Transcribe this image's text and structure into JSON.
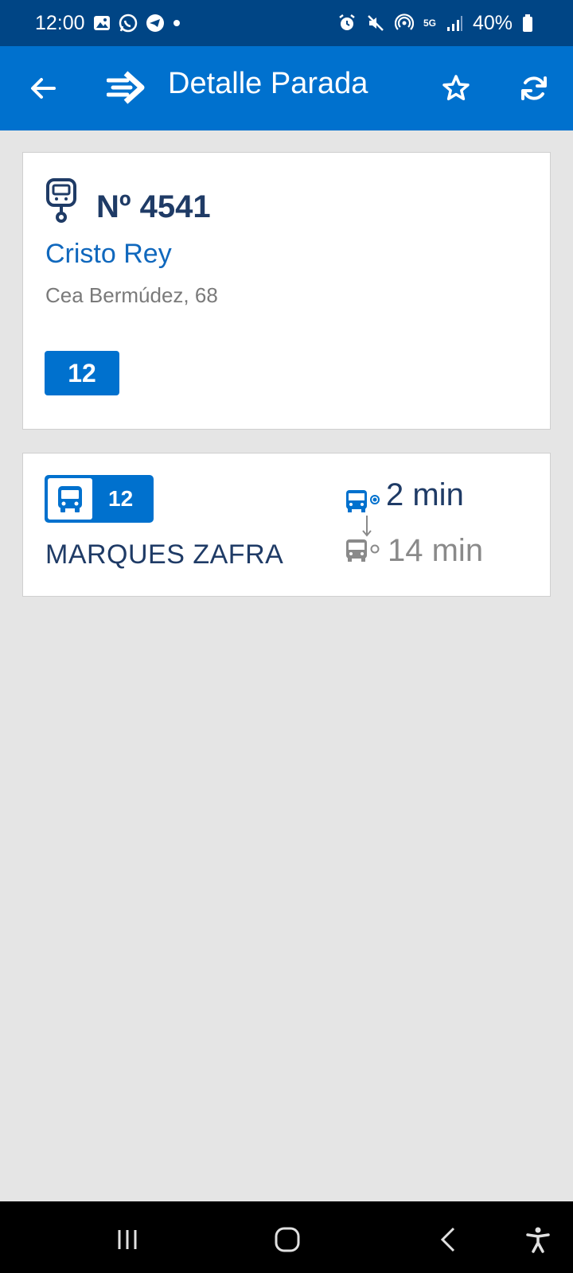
{
  "status_bar": {
    "time": "12:00",
    "battery": "40%",
    "network": "5G",
    "icons": [
      "gallery-icon",
      "whatsapp-icon",
      "telegram-icon",
      "dot-icon",
      "alarm-icon",
      "mute-icon",
      "hotspot-icon",
      "signal-icon",
      "battery-icon"
    ]
  },
  "app_bar": {
    "title": "Detalle Parada",
    "icons": [
      "back-arrow-icon",
      "app-logo-icon",
      "star-icon",
      "refresh-icon"
    ]
  },
  "stop": {
    "number": "Nº 4541",
    "name": "Cristo Rey",
    "address": "Cea Bermúdez, 68",
    "lines": [
      "12"
    ]
  },
  "arrivals": [
    {
      "line": "12",
      "destination": "MARQUES ZAFRA",
      "next": "2 min",
      "following": "14 min"
    }
  ],
  "colors": {
    "status_bar": "#004585",
    "primary": "#0071ce",
    "dark_text": "#1f3b66",
    "link_text": "#1068bd",
    "muted": "#8a8a8a",
    "background": "#e5e5e5"
  },
  "nav_bar": {
    "icons": [
      "recent-apps-icon",
      "home-icon",
      "back-icon",
      "accessibility-icon"
    ]
  }
}
